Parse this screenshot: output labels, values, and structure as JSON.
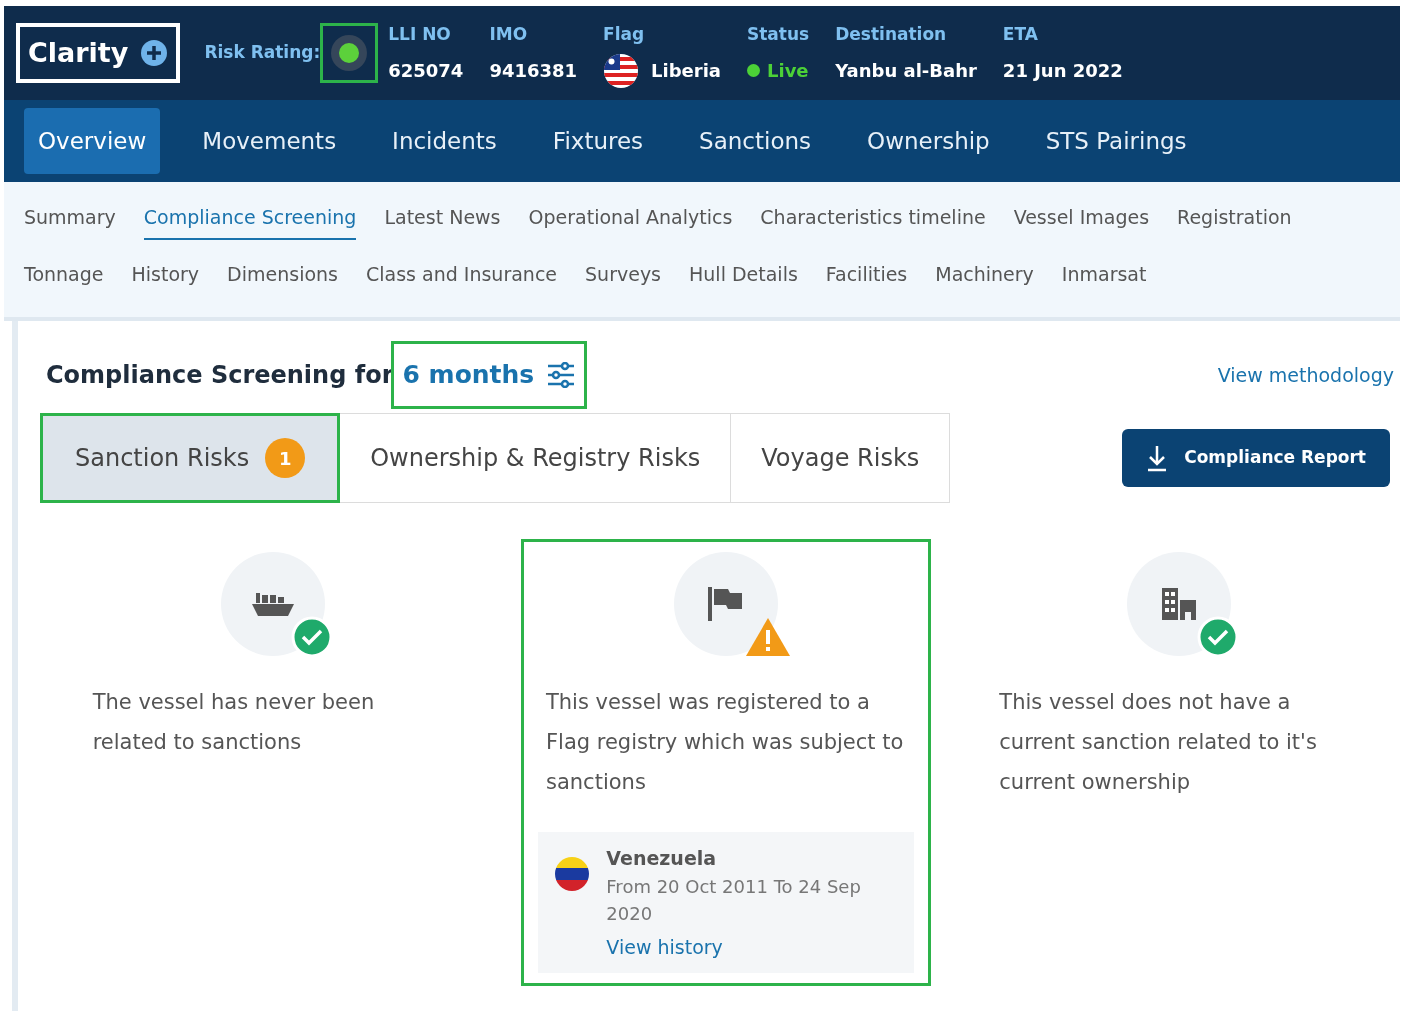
{
  "header": {
    "logo": "Clarity",
    "risk_rating": {
      "label": "Risk Rating:",
      "color": "#5cd13b",
      "highlighted": true
    },
    "fields": [
      {
        "kind": "text",
        "label": "LLI NO",
        "value": "625074"
      },
      {
        "kind": "text",
        "label": "IMO",
        "value": "9416381"
      },
      {
        "kind": "flag",
        "label": "Flag",
        "value": "Liberia"
      },
      {
        "kind": "status",
        "label": "Status",
        "value": "Live",
        "color": "#4cd137"
      },
      {
        "kind": "text",
        "label": "Destination",
        "value": "Yanbu al-Bahr"
      },
      {
        "kind": "text",
        "label": "ETA",
        "value": "21 Jun 2022"
      }
    ]
  },
  "main_tabs": [
    {
      "label": "Overview",
      "selected": true
    },
    {
      "label": "Movements",
      "selected": false
    },
    {
      "label": "Incidents",
      "selected": false
    },
    {
      "label": "Fixtures",
      "selected": false
    },
    {
      "label": "Sanctions",
      "selected": false
    },
    {
      "label": "Ownership",
      "selected": false
    },
    {
      "label": "STS Pairings",
      "selected": false
    }
  ],
  "sub_tabs": [
    [
      {
        "label": "Summary",
        "selected": false
      },
      {
        "label": "Compliance Screening",
        "selected": true
      },
      {
        "label": "Latest News",
        "selected": false
      },
      {
        "label": "Operational Analytics",
        "selected": false
      },
      {
        "label": "Characteristics timeline",
        "selected": false
      },
      {
        "label": "Vessel Images",
        "selected": false
      },
      {
        "label": "Registration",
        "selected": false
      }
    ],
    [
      {
        "label": "Tonnage",
        "selected": false
      },
      {
        "label": "History",
        "selected": false
      },
      {
        "label": "Dimensions",
        "selected": false
      },
      {
        "label": "Class and Insurance",
        "selected": false
      },
      {
        "label": "Surveys",
        "selected": false
      },
      {
        "label": "Hull Details",
        "selected": false
      },
      {
        "label": "Facilities",
        "selected": false
      },
      {
        "label": "Machinery",
        "selected": false
      },
      {
        "label": "Inmarsat",
        "selected": false
      }
    ]
  ],
  "screening": {
    "title": "Compliance Screening for",
    "period": "6 months",
    "period_highlighted": true,
    "methodology_link": "View methodology",
    "risk_tabs": [
      {
        "label": "Sanction Risks",
        "badge": "1",
        "selected": true,
        "highlighted": true
      },
      {
        "label": "Ownership & Registry Risks",
        "selected": false,
        "highlighted": false
      },
      {
        "label": "Voyage Risks",
        "selected": false,
        "highlighted": false
      }
    ],
    "report_button": "Compliance Report",
    "cards": [
      {
        "kind": "ok",
        "text": "The vessel has never been related to sanctions",
        "highlighted": false
      },
      {
        "kind": "warning",
        "text": "This vessel was registered to a Flag registry which was subject to sanctions",
        "highlighted": true,
        "detail": {
          "country": "Venezuela",
          "period": "From 20 Oct 2011 To 24 Sep 2020",
          "link": "View history"
        }
      },
      {
        "kind": "ok",
        "text": "This vessel does not have a current sanction related to it's current ownership",
        "highlighted": false
      }
    ]
  }
}
